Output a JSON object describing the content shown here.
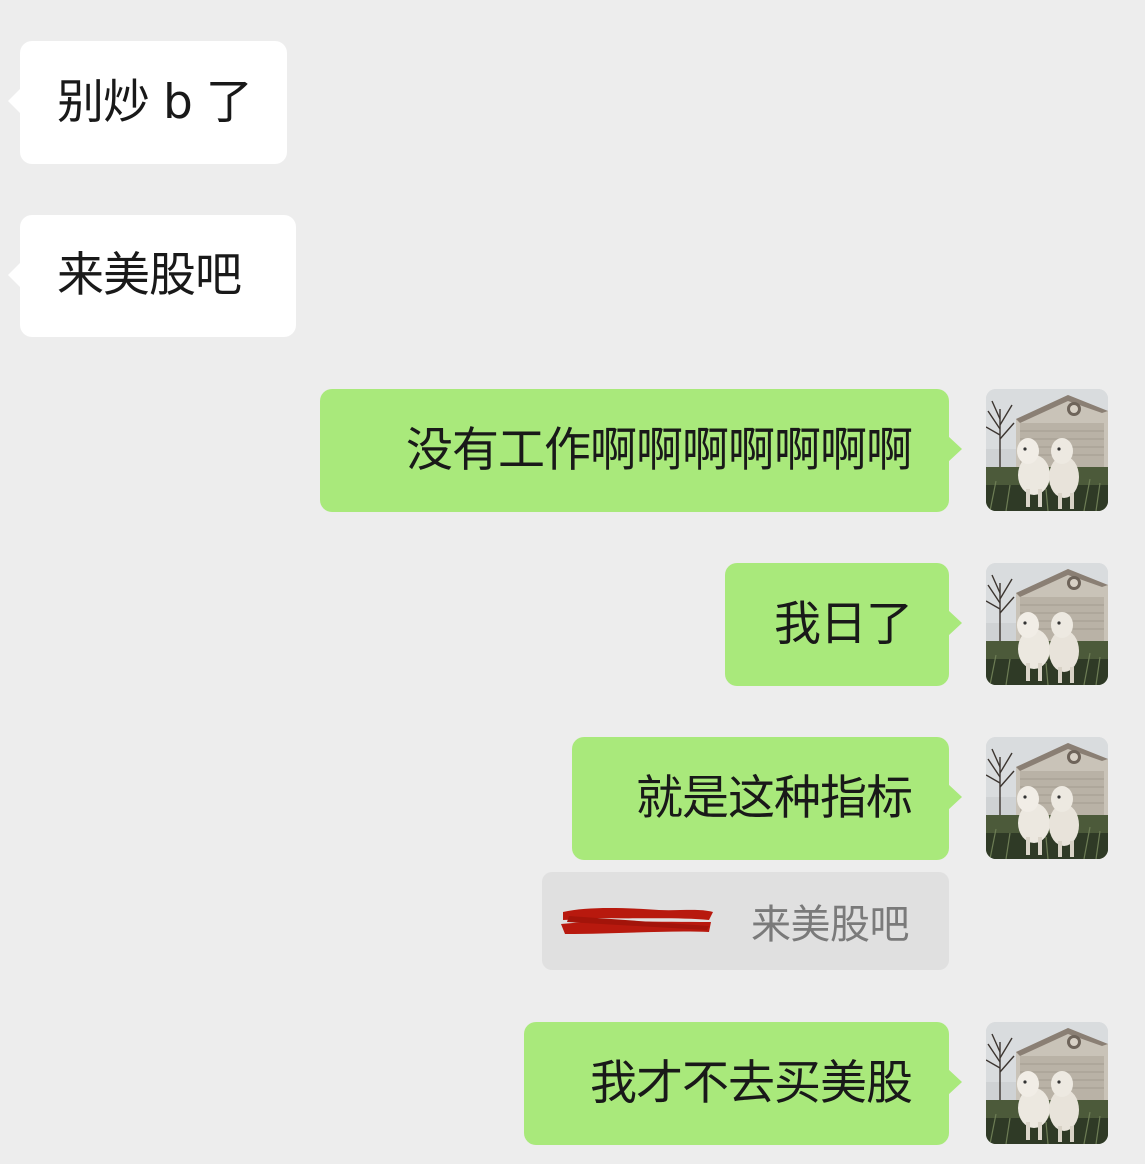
{
  "messages": [
    {
      "id": "m1",
      "side": "in",
      "text": "别炒 b 了"
    },
    {
      "id": "m2",
      "side": "in",
      "text": "来美股吧"
    },
    {
      "id": "m3",
      "side": "out",
      "text": "没有工作啊啊啊啊啊啊啊"
    },
    {
      "id": "m4",
      "side": "out",
      "text": "我日了"
    },
    {
      "id": "m5",
      "side": "out",
      "text": "就是这种指标"
    },
    {
      "id": "m6",
      "side": "out",
      "text": "我才不去买美股"
    }
  ],
  "quote": {
    "text": "来美股吧"
  },
  "colors": {
    "background": "#ededed",
    "incoming_bubble": "#ffffff",
    "outgoing_bubble": "#a9e97b",
    "quote_bg": "#e0e0e0",
    "redaction": "#b8190e"
  },
  "icons": {
    "avatar": "lamb-avatar-photo"
  }
}
